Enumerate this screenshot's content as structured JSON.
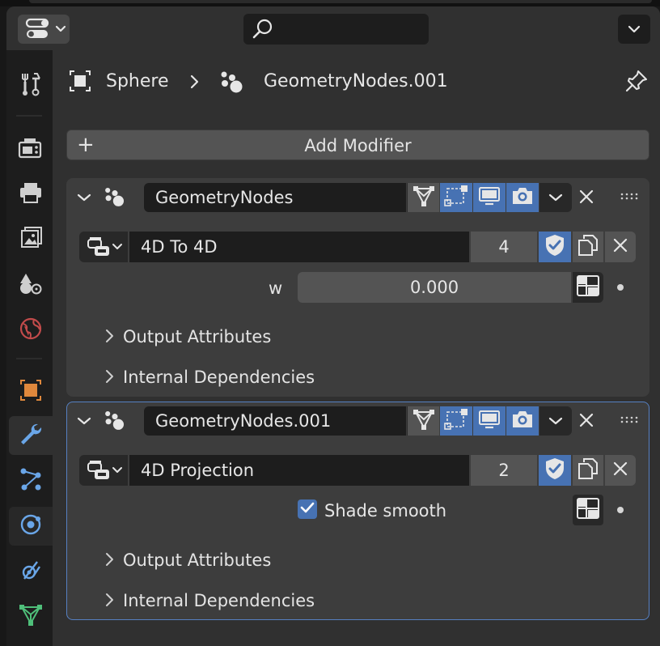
{
  "header": {
    "editor_type_icon": "properties-editor-icon",
    "search_icon": "search-icon",
    "search_placeholder": "",
    "options_icon": "chevron-down-icon"
  },
  "tabs": [
    {
      "name": "tool",
      "icon": "tool-icon"
    },
    {
      "name": "render",
      "icon": "render-icon"
    },
    {
      "name": "output",
      "icon": "output-icon"
    },
    {
      "name": "view-layer",
      "icon": "view-layer-icon"
    },
    {
      "name": "scene",
      "icon": "scene-icon"
    },
    {
      "name": "world",
      "icon": "world-icon"
    },
    {
      "name": "object",
      "icon": "object-icon"
    },
    {
      "name": "modifiers",
      "icon": "wrench-icon",
      "active": true
    },
    {
      "name": "particles",
      "icon": "particles-icon"
    },
    {
      "name": "physics",
      "icon": "physics-icon"
    },
    {
      "name": "constraints",
      "icon": "constraints-icon"
    },
    {
      "name": "data",
      "icon": "mesh-data-icon"
    }
  ],
  "breadcrumb": {
    "object_name": "Sphere",
    "modifier_name": "GeometryNodes.001"
  },
  "add_modifier_label": "Add Modifier",
  "modifiers": [
    {
      "name": "GeometryNodes",
      "node_group": "4D To 4D",
      "users": "4",
      "input_label": "w",
      "input_value": "0.000",
      "output_attributes": "Output Attributes",
      "internal_dependencies": "Internal Dependencies"
    },
    {
      "name": "GeometryNodes.001",
      "node_group": "4D Projection",
      "users": "2",
      "checkbox_label": "Shade smooth",
      "checkbox_checked": true,
      "output_attributes": "Output Attributes",
      "internal_dependencies": "Internal Dependencies"
    }
  ],
  "colors": {
    "accent": "#4772b3",
    "active_outline": "#5680c2",
    "panel": "#3d3d3d",
    "background": "#303030"
  }
}
